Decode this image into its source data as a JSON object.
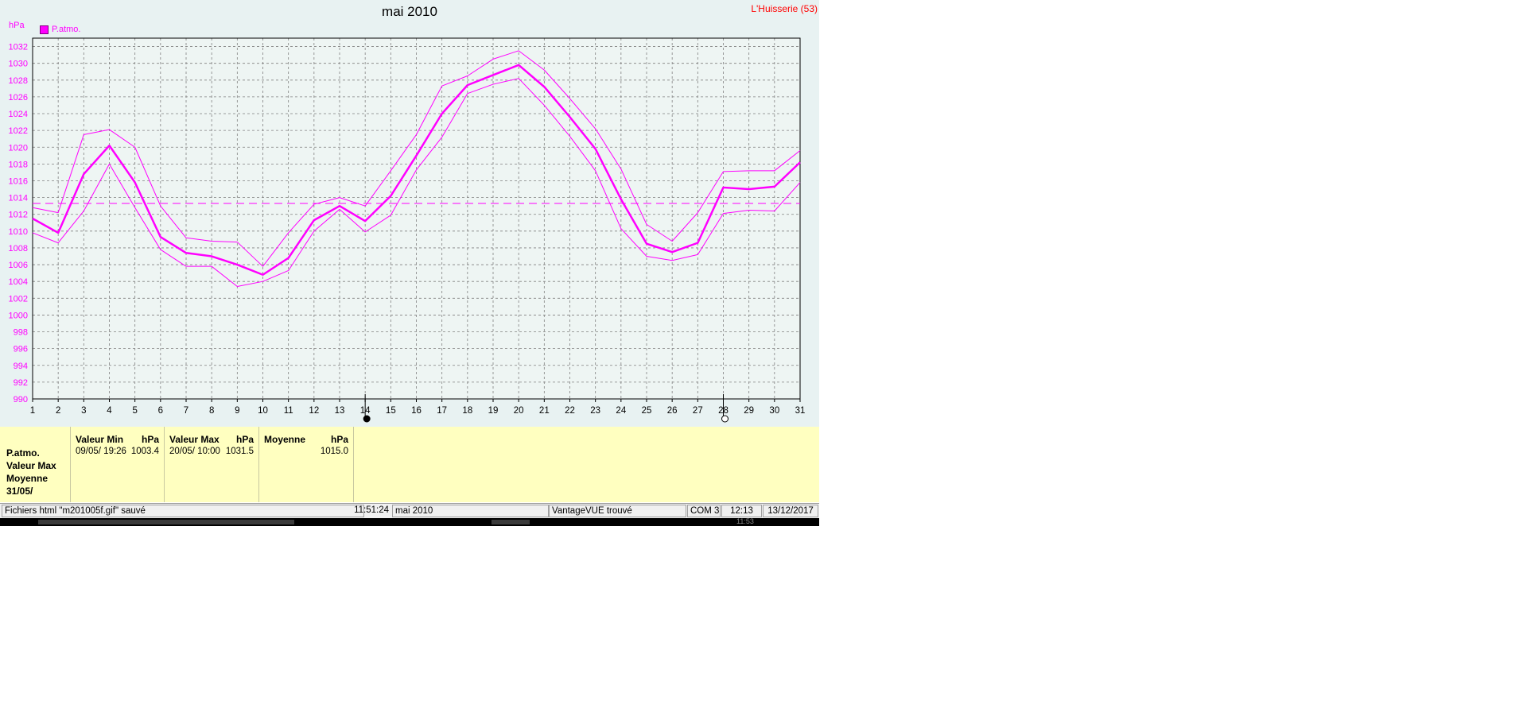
{
  "header": {
    "title": "mai 2010",
    "station": "L'Huisserie (53)",
    "unit": "hPa",
    "legend_label": "P.atmo."
  },
  "colors": {
    "series": "#ff00ff",
    "background": "#e8f2f2",
    "stats_bg": "#ffffc0",
    "station": "#ff0000"
  },
  "chart_data": {
    "type": "line",
    "title": "mai 2010",
    "ylabel": "hPa",
    "ylim": [
      990,
      1033
    ],
    "xlim": [
      1,
      31
    ],
    "grid": true,
    "legend": "top-left",
    "x": [
      1,
      2,
      3,
      4,
      5,
      6,
      7,
      8,
      9,
      10,
      11,
      12,
      13,
      14,
      15,
      16,
      17,
      18,
      19,
      20,
      21,
      22,
      23,
      24,
      25,
      26,
      27,
      28,
      29,
      30,
      31
    ],
    "y_ticks": [
      990,
      992,
      994,
      996,
      998,
      1000,
      1002,
      1004,
      1006,
      1008,
      1010,
      1012,
      1014,
      1016,
      1018,
      1020,
      1022,
      1024,
      1026,
      1028,
      1030,
      1032
    ],
    "series": [
      {
        "name": "P.atmo.",
        "role": "mean",
        "values": [
          1011.5,
          1009.8,
          1016.8,
          1020.2,
          1015.8,
          1009.3,
          1007.4,
          1007.0,
          1006.0,
          1004.8,
          1006.8,
          1011.3,
          1013.0,
          1011.2,
          1014.2,
          1019.0,
          1024.0,
          1027.4,
          1028.6,
          1029.8,
          1027.2,
          1023.6,
          1019.8,
          1013.8,
          1008.5,
          1007.5,
          1008.6,
          1015.2,
          1015.0,
          1015.3,
          1018.2
        ]
      },
      {
        "role": "max",
        "values": [
          1012.8,
          1012.2,
          1021.5,
          1022.1,
          1020.0,
          1013.0,
          1009.2,
          1008.8,
          1008.7,
          1005.8,
          1009.8,
          1013.2,
          1014.0,
          1013.0,
          1017.2,
          1021.5,
          1027.3,
          1028.5,
          1030.5,
          1031.5,
          1029.2,
          1025.8,
          1022.2,
          1017.4,
          1010.8,
          1008.8,
          1012.2,
          1017.1,
          1017.2,
          1017.2,
          1019.6
        ]
      },
      {
        "role": "min",
        "values": [
          1009.8,
          1008.6,
          1012.4,
          1018.0,
          1012.8,
          1007.8,
          1005.8,
          1005.8,
          1003.4,
          1004.0,
          1005.3,
          1010.0,
          1012.6,
          1009.9,
          1011.9,
          1017.3,
          1021.2,
          1026.4,
          1027.5,
          1028.2,
          1025.0,
          1021.3,
          1017.2,
          1010.3,
          1007.0,
          1006.5,
          1007.2,
          1012.1,
          1012.5,
          1012.4,
          1015.8
        ]
      }
    ],
    "average_line": 1013.3,
    "marker_days": [
      14,
      28
    ]
  },
  "stats": {
    "labels": [
      "P.atmo.",
      "Valeur Max",
      "Moyenne",
      "31/05/"
    ],
    "min": {
      "header": "Valeur Min",
      "unit": "hPa",
      "date": "09/05/  19:26",
      "value": "1003.4"
    },
    "max": {
      "header": "Valeur Max",
      "unit": "hPa",
      "date": "20/05/  10:00",
      "value": "1031.5"
    },
    "avg": {
      "header": "Moyenne",
      "unit": "hPa",
      "date": "",
      "value": "1015.0"
    }
  },
  "statusbar": {
    "message": "Fichiers html  \"m201005f.gif\"  sauvé",
    "time": "11:51:24",
    "period": "mai 2010",
    "device": "VantageVUE trouvé",
    "port": "COM 3",
    "clock": "12:13",
    "date": "13/12/2017"
  },
  "taskbar": {
    "clock": "11:53"
  }
}
